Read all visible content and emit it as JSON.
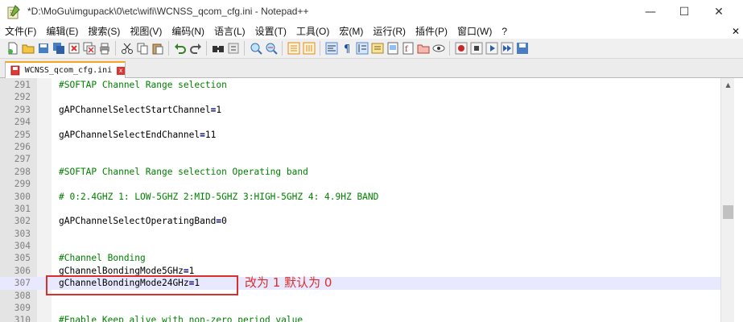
{
  "window": {
    "title": "*D:\\MoGu\\imgupack\\0\\etc\\wifi\\WCNSS_qcom_cfg.ini - Notepad++",
    "minimize": "—",
    "maximize": "☐",
    "close": "✕"
  },
  "menu": [
    "文件(F)",
    "编辑(E)",
    "搜索(S)",
    "视图(V)",
    "编码(N)",
    "语言(L)",
    "设置(T)",
    "工具(O)",
    "宏(M)",
    "运行(R)",
    "插件(P)",
    "窗口(W)",
    "?"
  ],
  "menu_close": "✕",
  "tab": {
    "label": "WCNSS_qcom_cfg.ini",
    "close": "x"
  },
  "editor": {
    "lines": [
      {
        "n": "291",
        "segments": [
          {
            "t": "#SOFTAP Channel Range selection",
            "c": "comment"
          }
        ]
      },
      {
        "n": "292",
        "segments": []
      },
      {
        "n": "293",
        "segments": [
          {
            "t": "gAPChannelSelectStartChannel",
            "c": "normal"
          },
          {
            "t": "=",
            "c": "op"
          },
          {
            "t": "1",
            "c": "normal"
          }
        ]
      },
      {
        "n": "294",
        "segments": []
      },
      {
        "n": "295",
        "segments": [
          {
            "t": "gAPChannelSelectEndChannel",
            "c": "normal"
          },
          {
            "t": "=",
            "c": "op"
          },
          {
            "t": "11",
            "c": "normal"
          }
        ]
      },
      {
        "n": "296",
        "segments": []
      },
      {
        "n": "297",
        "segments": []
      },
      {
        "n": "298",
        "segments": [
          {
            "t": "#SOFTAP Channel Range selection Operating band",
            "c": "comment"
          }
        ]
      },
      {
        "n": "299",
        "segments": []
      },
      {
        "n": "300",
        "segments": [
          {
            "t": "# 0:2.4GHZ 1: LOW-5GHZ 2:MID-5GHZ 3:HIGH-5GHZ 4: 4.9HZ BAND",
            "c": "comment"
          }
        ]
      },
      {
        "n": "301",
        "segments": []
      },
      {
        "n": "302",
        "segments": [
          {
            "t": "gAPChannelSelectOperatingBand",
            "c": "normal"
          },
          {
            "t": "=",
            "c": "op"
          },
          {
            "t": "0",
            "c": "normal"
          }
        ]
      },
      {
        "n": "303",
        "segments": []
      },
      {
        "n": "304",
        "segments": []
      },
      {
        "n": "305",
        "segments": [
          {
            "t": "#Channel Bonding",
            "c": "comment"
          }
        ]
      },
      {
        "n": "306",
        "segments": [
          {
            "t": "gChannelBondingMode5GHz",
            "c": "normal"
          },
          {
            "t": "=",
            "c": "op"
          },
          {
            "t": "1",
            "c": "normal"
          }
        ]
      },
      {
        "n": "307",
        "segments": [
          {
            "t": "gChannelBondingMode24GHz",
            "c": "normal"
          },
          {
            "t": "=",
            "c": "op"
          },
          {
            "t": "1",
            "c": "normal"
          }
        ],
        "current": true
      },
      {
        "n": "308",
        "segments": []
      },
      {
        "n": "309",
        "segments": []
      },
      {
        "n": "310",
        "segments": [
          {
            "t": "#Enable Keep alive with non-zero period value",
            "c": "comment"
          }
        ]
      }
    ]
  },
  "annotation": {
    "text": "改为 1 默认为 0",
    "color": "#d9302c"
  },
  "colors": {
    "comment": "#008000",
    "operator": "#000080",
    "current_line": "#e8e8ff",
    "tab_accent": "#f5a623"
  }
}
